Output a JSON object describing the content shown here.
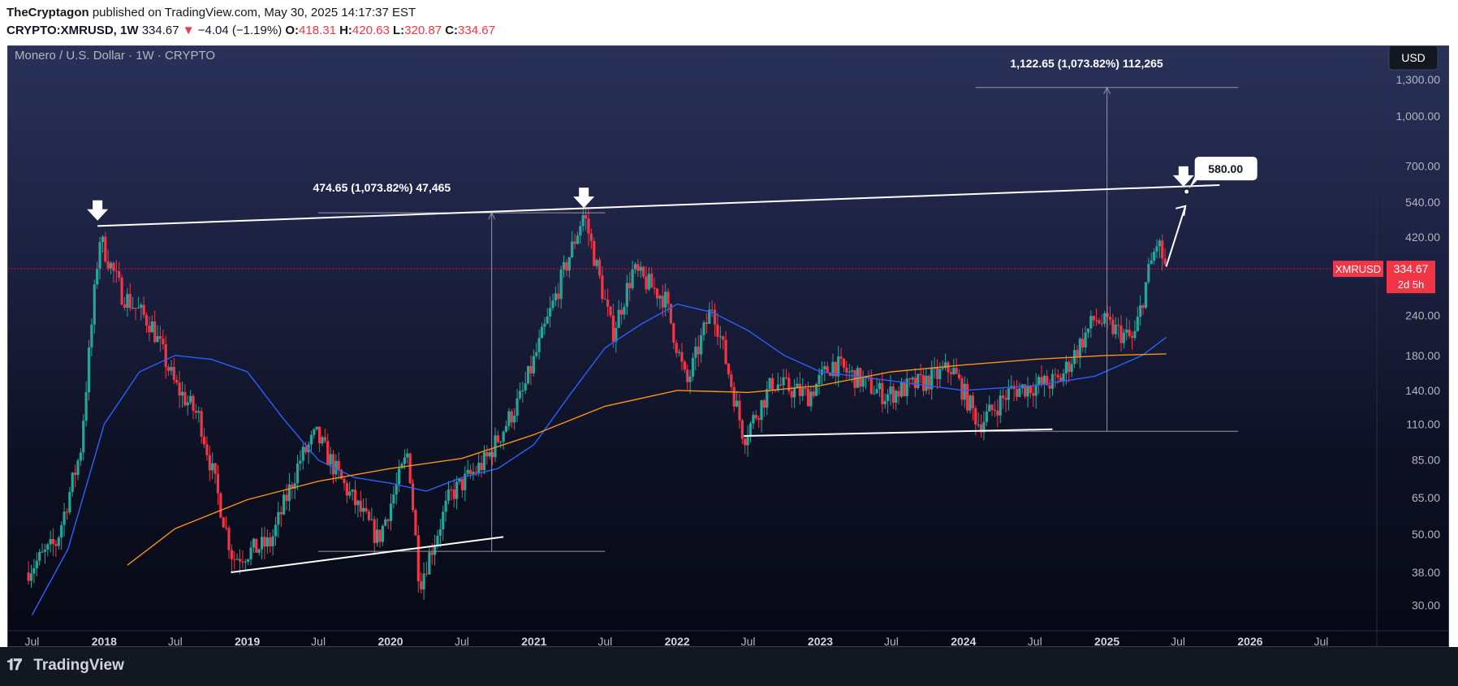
{
  "header": {
    "author": "TheCryptagon",
    "published_text": "published on TradingView.com, May 30, 2025 14:17:37 EST",
    "symbol": "CRYPTO:XMRUSD, 1W",
    "price": "334.67",
    "change_arrow": "▼",
    "change": "−4.04 (−1.19%)",
    "o_label": "O:",
    "o_value": "418.31",
    "h_label": "H:",
    "h_value": "420.63",
    "l_label": "L:",
    "l_value": "320.87",
    "c_label": "C:",
    "c_value": "334.67"
  },
  "chart": {
    "legend_title": "Monero / U.S. Dollar · 1W · CRYPTO",
    "currency_button": "USD",
    "symbol_tag": "XMRUSD",
    "price_tag": "334.67",
    "countdown_tag": "2d 5h",
    "target_label": "580.00",
    "measure_1": "474.65 (1,073.82%) 47,465",
    "measure_2": "1,122.65 (1,073.82%) 112,265"
  },
  "footer": {
    "logo_text": "TradingView"
  },
  "colors": {
    "up": "#26a69a",
    "down": "#f23645",
    "ma_fast": "#2962ff",
    "ma_slow": "#f7931a",
    "trendline": "#ffffff",
    "price_line": "#f23645"
  },
  "chart_data": {
    "type": "candlestick",
    "title": "Monero / U.S. Dollar · 1W · CRYPTO",
    "scale": "log",
    "currency": "USD",
    "x_ticks": [
      "Jul",
      "2018",
      "Jul",
      "2019",
      "Jul",
      "2020",
      "Jul",
      "2021",
      "Jul",
      "2022",
      "Jul",
      "2023",
      "Jul",
      "2024",
      "Jul",
      "2025",
      "Jul",
      "2026",
      "Jul"
    ],
    "y_ticks": [
      30,
      38,
      50,
      65,
      85,
      110,
      140,
      180,
      240,
      420,
      540,
      700,
      1000,
      1300
    ],
    "y_tick_labels": [
      "30.00",
      "38.00",
      "50.00",
      "65.00",
      "85.00",
      "110.00",
      "140.00",
      "180.00",
      "240.00",
      "420.00",
      "540.00",
      "700.00",
      "1,000.00",
      "1,300.00"
    ],
    "ylim": [
      25,
      1650
    ],
    "last_price": 334.67,
    "price_path": [
      [
        "2017-06-15",
        38
      ],
      [
        "2017-09-01",
        47
      ],
      [
        "2017-11-01",
        90
      ],
      [
        "2017-12-20",
        420
      ],
      [
        "2018-02-15",
        280
      ],
      [
        "2018-05-01",
        225
      ],
      [
        "2018-07-01",
        145
      ],
      [
        "2018-09-01",
        115
      ],
      [
        "2018-11-25",
        42
      ],
      [
        "2019-03-01",
        47
      ],
      [
        "2019-05-15",
        85
      ],
      [
        "2019-06-25",
        102
      ],
      [
        "2019-09-01",
        72
      ],
      [
        "2019-12-01",
        48
      ],
      [
        "2020-02-15",
        90
      ],
      [
        "2020-03-15",
        35
      ],
      [
        "2020-06-01",
        66
      ],
      [
        "2020-09-01",
        85
      ],
      [
        "2020-12-01",
        135
      ],
      [
        "2021-02-01",
        225
      ],
      [
        "2021-05-08",
        500
      ],
      [
        "2021-07-20",
        210
      ],
      [
        "2021-09-10",
        330
      ],
      [
        "2021-12-01",
        270
      ],
      [
        "2022-01-25",
        145
      ],
      [
        "2022-04-01",
        260
      ],
      [
        "2022-06-20",
        100
      ],
      [
        "2022-09-01",
        148
      ],
      [
        "2022-12-01",
        135
      ],
      [
        "2023-02-01",
        170
      ],
      [
        "2023-06-15",
        135
      ],
      [
        "2023-10-01",
        150
      ],
      [
        "2023-12-01",
        165
      ],
      [
        "2024-02-10",
        110
      ],
      [
        "2024-05-01",
        140
      ],
      [
        "2024-09-01",
        150
      ],
      [
        "2024-12-01",
        235
      ],
      [
        "2025-03-10",
        200
      ],
      [
        "2025-04-15",
        320
      ],
      [
        "2025-05-10",
        410
      ],
      [
        "2025-05-30",
        334.67
      ]
    ],
    "series": [
      {
        "name": "",
        "color": "#2962ff",
        "points": [
          [
            "2017-07-01",
            28
          ],
          [
            "2017-10-01",
            45
          ],
          [
            "2018-01-01",
            110
          ],
          [
            "2018-04-01",
            160
          ],
          [
            "2018-07-01",
            180
          ],
          [
            "2018-10-01",
            175
          ],
          [
            "2019-01-01",
            160
          ],
          [
            "2019-04-01",
            115
          ],
          [
            "2019-07-01",
            85
          ],
          [
            "2019-10-01",
            75
          ],
          [
            "2020-01-01",
            72
          ],
          [
            "2020-04-01",
            68
          ],
          [
            "2020-07-01",
            75
          ],
          [
            "2020-10-01",
            80
          ],
          [
            "2021-01-01",
            95
          ],
          [
            "2021-04-01",
            135
          ],
          [
            "2021-07-01",
            190
          ],
          [
            "2021-10-01",
            225
          ],
          [
            "2022-01-01",
            260
          ],
          [
            "2022-04-01",
            245
          ],
          [
            "2022-07-01",
            215
          ],
          [
            "2022-10-01",
            180
          ],
          [
            "2023-01-01",
            160
          ],
          [
            "2023-07-01",
            150
          ],
          [
            "2024-01-01",
            140
          ],
          [
            "2024-07-01",
            145
          ],
          [
            "2024-12-01",
            155
          ],
          [
            "2025-04-01",
            180
          ],
          [
            "2025-06-01",
            205
          ]
        ]
      },
      {
        "name": "",
        "color": "#f7931a",
        "points": [
          [
            "2018-03-01",
            40
          ],
          [
            "2018-07-01",
            52
          ],
          [
            "2019-01-01",
            64
          ],
          [
            "2019-07-01",
            73
          ],
          [
            "2020-01-01",
            80
          ],
          [
            "2020-07-01",
            86
          ],
          [
            "2021-01-01",
            102
          ],
          [
            "2021-07-01",
            125
          ],
          [
            "2022-01-01",
            140
          ],
          [
            "2022-07-01",
            138
          ],
          [
            "2023-01-01",
            145
          ],
          [
            "2023-07-01",
            160
          ],
          [
            "2024-01-01",
            168
          ],
          [
            "2024-07-01",
            175
          ],
          [
            "2025-01-01",
            180
          ],
          [
            "2025-06-01",
            182
          ]
        ]
      }
    ],
    "trendlines": [
      {
        "name": "resistance",
        "from": [
          "2017-12-15",
          455
        ],
        "to": [
          "2025-10-15",
          610
        ]
      },
      {
        "name": "support-2019",
        "from": [
          "2018-11-20",
          38
        ],
        "to": [
          "2020-10-15",
          49
        ]
      },
      {
        "name": "support-2022",
        "from": [
          "2022-06-20",
          101
        ],
        "to": [
          "2024-08-15",
          106
        ]
      }
    ],
    "annotations": [
      {
        "type": "arrow-down",
        "at": [
          "2017-12-15",
          470
        ]
      },
      {
        "type": "arrow-down",
        "at": [
          "2021-05-08",
          515
        ]
      },
      {
        "type": "arrow-down",
        "at": [
          "2025-07-15",
          600
        ]
      },
      {
        "type": "target",
        "at": [
          "2025-07-23",
          582
        ],
        "label": "580.00"
      },
      {
        "type": "projection",
        "from": [
          "2025-06-01",
          340
        ],
        "to": [
          "2025-07-20",
          525
        ]
      }
    ],
    "measurements": [
      {
        "label": "474.65 (1,073.82%) 47,465",
        "x": "2020-09-15",
        "from": 44.2,
        "to": 500,
        "span": [
          "2019-07-01",
          "2021-07-01"
        ]
      },
      {
        "label": "1,122.65 (1,073.82%) 112,265",
        "x": "2025-01-01",
        "from": 104.5,
        "to": 1228,
        "span": [
          "2024-02-01",
          "2025-12-01"
        ]
      }
    ]
  }
}
